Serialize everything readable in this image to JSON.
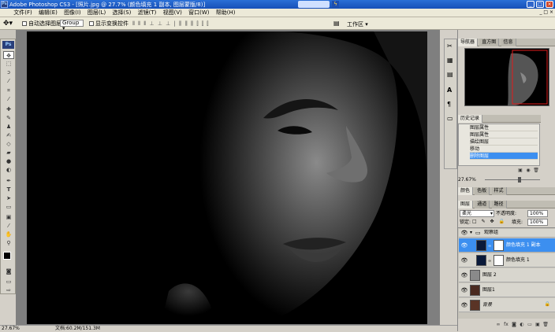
{
  "window": {
    "title": "Adobe Photoshop CS3 - [照片.jpg @ 27.7% (颜色填充 1 副本, 图层蒙版/8)]",
    "app_badge": "Ps"
  },
  "menu": [
    "文件(F)",
    "编辑(E)",
    "图像(I)",
    "图层(L)",
    "选择(S)",
    "滤镜(T)",
    "视图(V)",
    "窗口(W)",
    "帮助(H)"
  ],
  "options": {
    "auto_select_label": "自动选择图层",
    "group_value": "Group",
    "transform_label": "显示变换控件",
    "workspace_label": "工作区 ▾"
  },
  "navigator": {
    "tabs": [
      "导航器",
      "直方图",
      "信息"
    ],
    "zoom": "27.67%"
  },
  "history": {
    "tab": "历史记录",
    "items": [
      "图层属性",
      "图层属性",
      "描绘图层",
      "移动",
      "删除图层"
    ]
  },
  "color_panel": {
    "tabs": [
      "颜色",
      "色板",
      "样式"
    ]
  },
  "layers": {
    "tabs": [
      "图层",
      "通道",
      "路径"
    ],
    "blend_mode": "柔光",
    "opacity_label": "不透明度:",
    "opacity_value": "100%",
    "lock_label": "锁定:",
    "fill_label": "填充:",
    "fill_value": "100%",
    "items": [
      {
        "name": "观察组"
      },
      {
        "name": "颜色填充 1 副本"
      },
      {
        "name": "颜色填充 1"
      },
      {
        "name": "图层 2"
      },
      {
        "name": "图层1"
      },
      {
        "name": "背景"
      }
    ]
  },
  "status": {
    "zoom": "27.67%",
    "doc_info": "文档:60.2M/151.3M"
  },
  "colors": {
    "title_blue": "#1750b8",
    "selection_blue": "#3c8ff0",
    "canvas_black": "#000000"
  }
}
